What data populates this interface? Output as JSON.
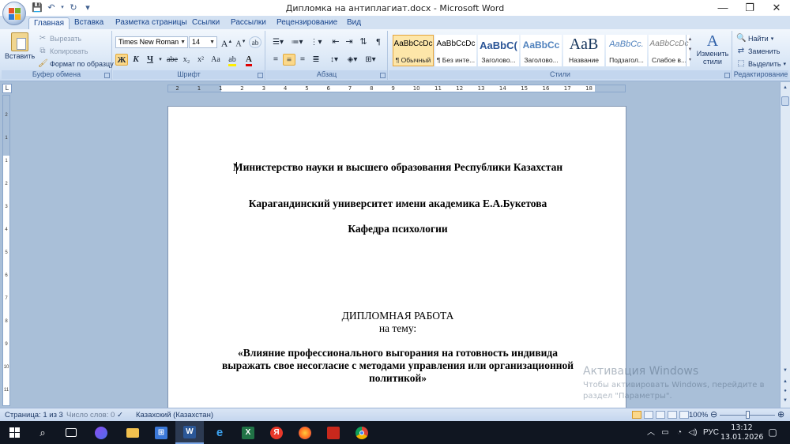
{
  "window": {
    "title": "Дипломка на антиплагиат.docx - Microsoft Word",
    "minimize": "—",
    "maximize": "❐",
    "close": "✕"
  },
  "qat": {
    "save": "💾",
    "undo": "↶",
    "redo": "↻",
    "customize": "▾"
  },
  "tabs": [
    {
      "label": "Главная",
      "active": true
    },
    {
      "label": "Вставка"
    },
    {
      "label": "Разметка страницы"
    },
    {
      "label": "Ссылки"
    },
    {
      "label": "Рассылки"
    },
    {
      "label": "Рецензирование"
    },
    {
      "label": "Вид"
    }
  ],
  "clipboard": {
    "paste": "Вставить",
    "cut": "Вырезать",
    "copy": "Копировать",
    "format_painter": "Формат по образцу",
    "group_label": "Буфер обмена"
  },
  "font": {
    "family": "Times New Roman",
    "size": "14",
    "bold": "Ж",
    "italic": "К",
    "underline": "Ч",
    "strike": "abe",
    "subscript": "x₂",
    "superscript": "x²",
    "change_case": "Aa",
    "group_label": "Шрифт"
  },
  "paragraph": {
    "group_label": "Абзац"
  },
  "styles": {
    "items": [
      {
        "sample": "AaBbCcDc",
        "name": "¶ Обычный",
        "selected": true
      },
      {
        "sample": "AaBbCcDc",
        "name": "¶ Без инте..."
      },
      {
        "sample": "AaBbC(",
        "name": "Заголово..."
      },
      {
        "sample": "AaBbCc",
        "name": "Заголово..."
      },
      {
        "sample": "AaB",
        "name": "Название"
      },
      {
        "sample": "AaBbCc.",
        "name": "Подзагол..."
      },
      {
        "sample": "AaBbCcDc",
        "name": "Слабое в..."
      }
    ],
    "change_styles": "Изменить стили",
    "group_label": "Стили"
  },
  "editing": {
    "find": "Найти",
    "replace": "Заменить",
    "select": "Выделить",
    "group_label": "Редактирование"
  },
  "ruler": {
    "h_ticks": [
      "2",
      "1",
      "1",
      "2",
      "3",
      "4",
      "5",
      "6",
      "7",
      "8",
      "9",
      "10",
      "11",
      "12",
      "13",
      "14",
      "15",
      "16",
      "17",
      "18"
    ],
    "v_ticks": [
      "2",
      "1",
      "1",
      "2",
      "3",
      "4",
      "5",
      "6",
      "7",
      "8",
      "9",
      "10",
      "11"
    ]
  },
  "document": {
    "line1": "Министерство науки и высшего образования Республики Казахстан",
    "line2": "Карагандинский университет имени академика Е.А.Букетова",
    "line3": "Кафедра психологии",
    "line4": "ДИПЛОМНАЯ РАБОТА",
    "line5": "на тему:",
    "line6": "«Влияние профессионального выгорания на готовность индивида",
    "line7": "выражать свое несогласие с методами управления или организационной",
    "line8": "политикой»"
  },
  "watermark": {
    "title": "Активация Windows",
    "line1": "Чтобы активировать Windows, перейдите в",
    "line2": "раздел \"Параметры\"."
  },
  "status": {
    "page": "Страница: 1 из 3",
    "words": "Число слов: 0",
    "language": "Казахский (Казахстан)",
    "zoom": "100%"
  },
  "taskbar": {
    "lang": "РУС",
    "time": "13:12",
    "date": "13.01.2026"
  },
  "colors": {
    "accent": "#15428b",
    "ribbon": "#dde9f7",
    "workspace": "#a9bfd8",
    "taskbar": "#101621"
  }
}
